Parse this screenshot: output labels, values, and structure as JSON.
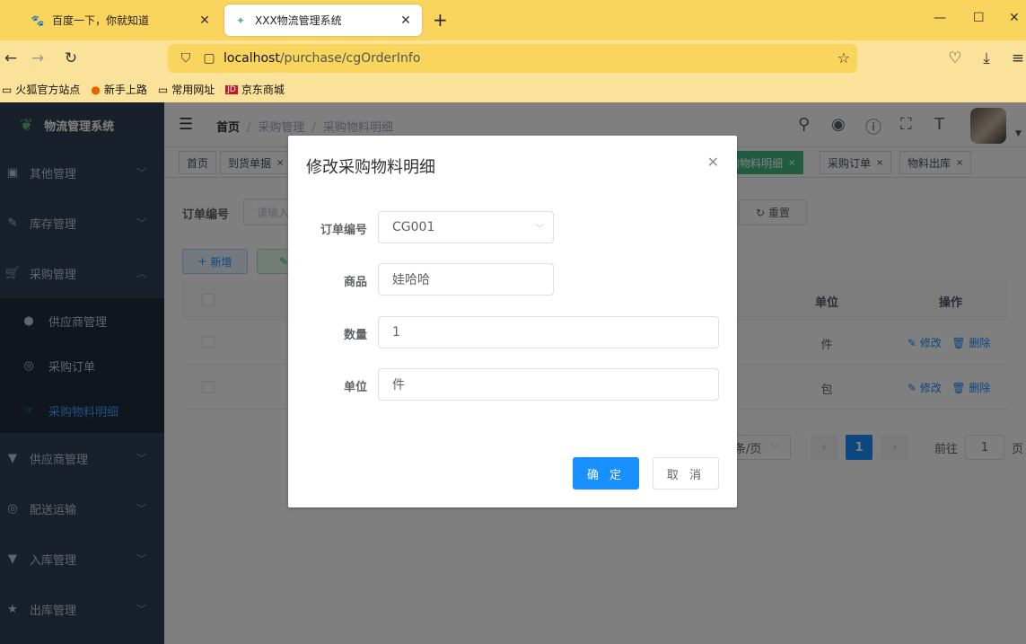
{
  "browser": {
    "tabs": [
      {
        "title": "百度一下，你就知道",
        "icon": "baidu-paw-icon"
      },
      {
        "title": "XXX物流管理系统",
        "icon": "site-logo-icon"
      }
    ],
    "url_host": "localhost",
    "url_path": "/purchase/cgOrderInfo",
    "bookmarks": [
      "火狐官方站点",
      "新手上路",
      "常用网址",
      "京东商城"
    ]
  },
  "sidebar": {
    "logo_text": "物流管理系统",
    "items": [
      {
        "label": "其他管理",
        "icon": "briefcase-icon"
      },
      {
        "label": "库存管理",
        "icon": "edit-icon"
      },
      {
        "label": "采购管理",
        "icon": "cart-icon"
      },
      {
        "label": "供应商管理",
        "icon": "shirt-icon"
      },
      {
        "label": "配送运输",
        "icon": "target-icon"
      },
      {
        "label": "入库管理",
        "icon": "shirt-icon"
      },
      {
        "label": "出库管理",
        "icon": "star-icon"
      }
    ],
    "sub_items": [
      {
        "label": "供应商管理",
        "icon": "user-icon"
      },
      {
        "label": "采购订单",
        "icon": "target-icon"
      },
      {
        "label": "采购物料明细",
        "icon": "hand-icon"
      }
    ]
  },
  "header": {
    "breadcrumbs": [
      "首页",
      "采购管理",
      "采购物料明细"
    ]
  },
  "tags": [
    "首页",
    "到货单据",
    "购物料明细",
    "采购订单",
    "物料出库"
  ],
  "list": {
    "search_label": "订单编号",
    "search_placeholder": "请输入",
    "reset_label": "重置",
    "add_label": "新增",
    "columns": {
      "unit": "单位",
      "ops": "操作"
    },
    "rows": [
      {
        "unit": "件"
      },
      {
        "unit": "包"
      }
    ],
    "edit_link": "修改",
    "delete_link": "删除",
    "page_size_suffix": "条/页",
    "current_page": "1",
    "goto_prefix": "前往",
    "goto_value": "1",
    "goto_suffix": "页"
  },
  "dialog": {
    "title": "修改采购物料明细",
    "fields": [
      {
        "label": "订单编号",
        "value": "CG001"
      },
      {
        "label": "商品",
        "value": "娃哈哈"
      },
      {
        "label": "数量",
        "value": "1"
      },
      {
        "label": "单位",
        "value": "件"
      }
    ],
    "confirm_label": "确 定",
    "cancel_label": "取 消"
  },
  "colors": {
    "primary": "#1890ff",
    "sidebar_bg": "#304156",
    "tag_active": "#42b983",
    "browser_chrome": "#f9d55e"
  }
}
